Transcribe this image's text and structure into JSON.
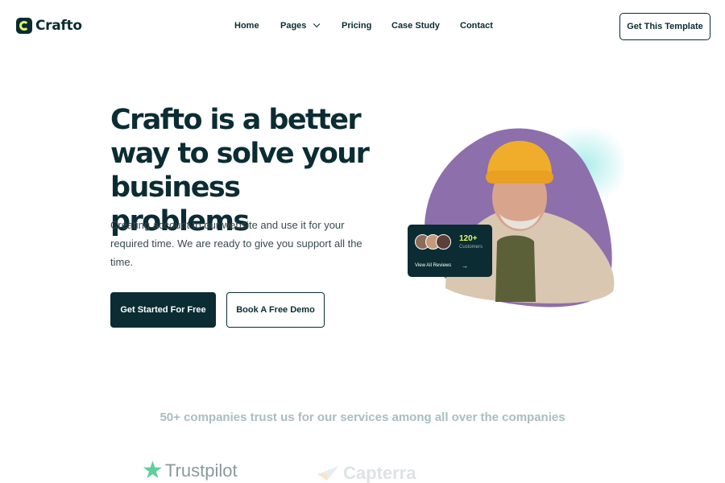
{
  "brand": {
    "name": "Crafto",
    "accent": "#e9f563",
    "primary": "#0b2c33"
  },
  "nav": {
    "items": [
      {
        "label": "Home"
      },
      {
        "label": "Pages"
      },
      {
        "label": "Pricing"
      },
      {
        "label": "Case Study"
      },
      {
        "label": "Contact"
      }
    ],
    "cta": "Get This Template"
  },
  "hero": {
    "title": "Crafto is a better way to solve your business problems",
    "subtitle": "Creating account to our website and use it for your required time. We are ready to give you support all the time.",
    "primary_button": "Get Started For Free",
    "secondary_button": "Book A Free Demo"
  },
  "review_card": {
    "count": "120+",
    "count_label": "Customers",
    "link": "View All Reviews",
    "icons": [
      "avatar",
      "avatar",
      "avatar",
      "arrow-right-icon"
    ]
  },
  "trust": {
    "text": "50+ companies trust us for our services among all over the companies",
    "logos": [
      "Trustpilot",
      "Capterra"
    ]
  }
}
